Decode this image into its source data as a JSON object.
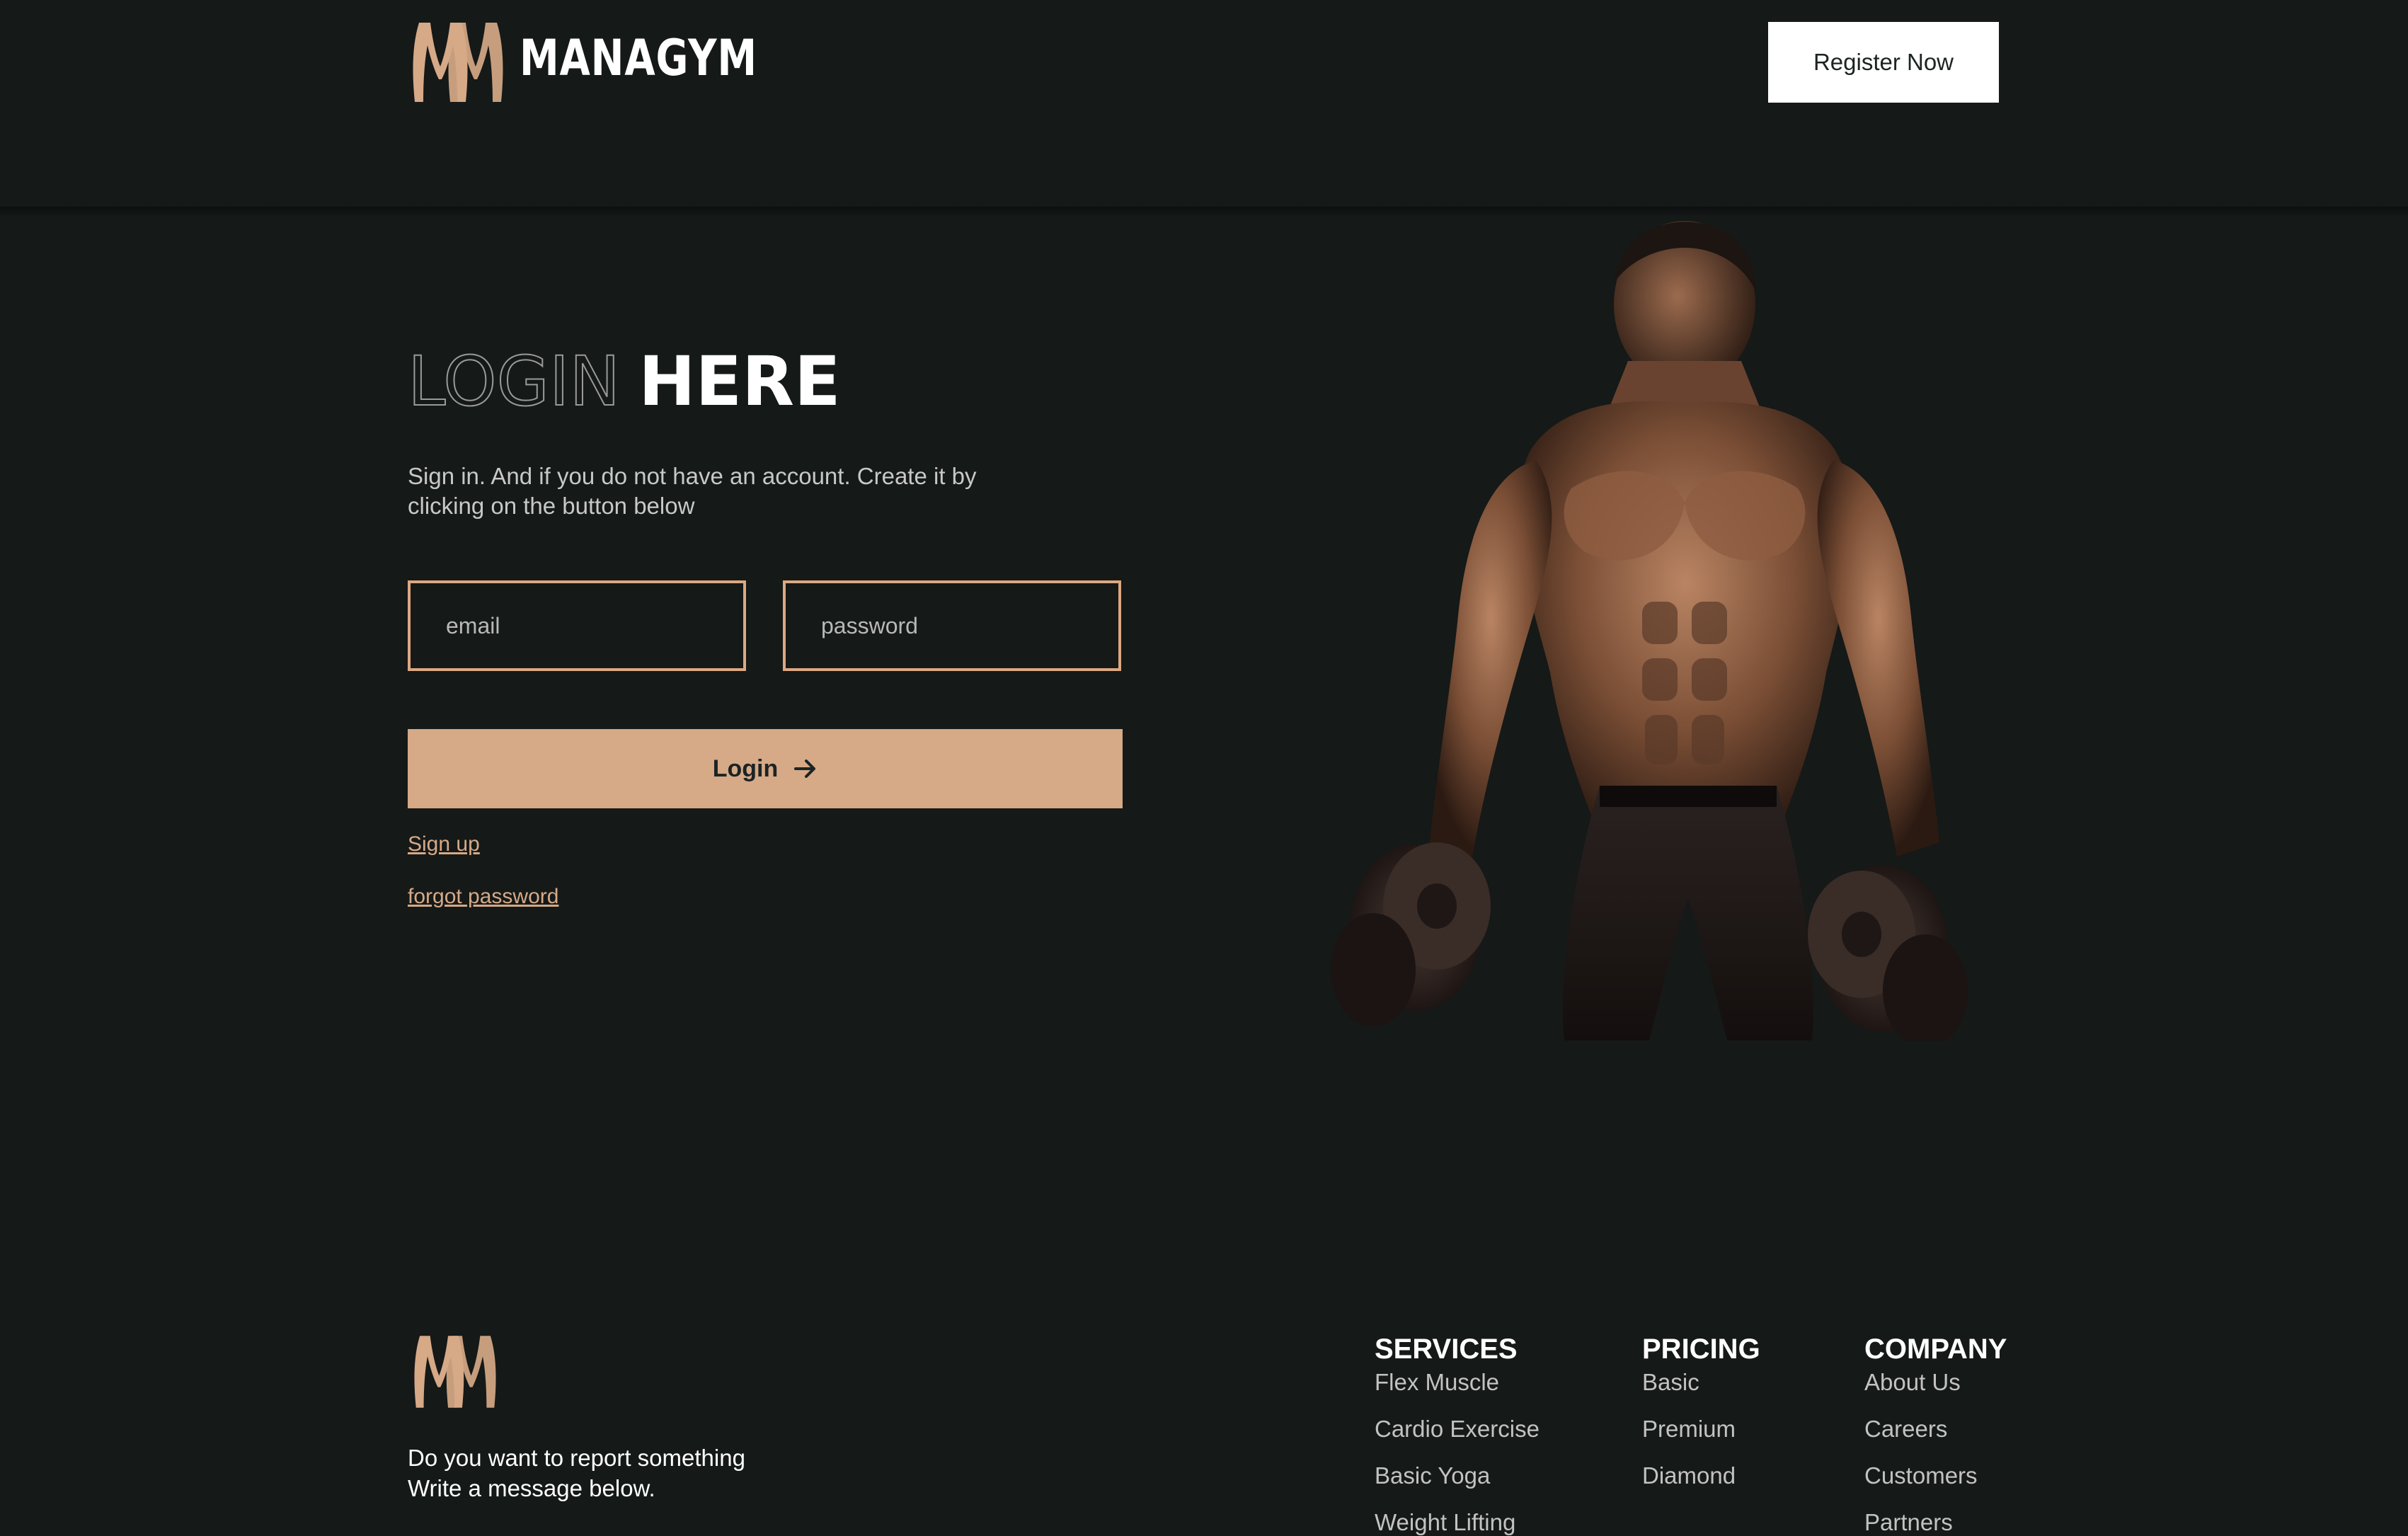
{
  "header": {
    "brand": "MANAGYM",
    "register_label": "Register Now"
  },
  "login": {
    "title_outline": "LOGIN",
    "title_solid": "HERE",
    "subtitle_line1": "Sign in. And if you do not have an account. Create it by",
    "subtitle_line2": "clicking on the button below",
    "email_placeholder": "email",
    "password_placeholder": "password",
    "login_label": "Login",
    "signup_label": "Sign up",
    "forgot_label": "forgot password"
  },
  "footer": {
    "report_line1": "Do you want to report something",
    "report_line2": "Write a message below.",
    "columns": [
      {
        "title": "SERVICES",
        "items": [
          "Flex Muscle",
          "Cardio Exercise",
          "Basic Yoga",
          "Weight Lifting"
        ]
      },
      {
        "title": "PRICING",
        "items": [
          "Basic",
          "Premium",
          "Diamond"
        ]
      },
      {
        "title": "COMPANY",
        "items": [
          "About Us",
          "Careers",
          "Customers",
          "Partners"
        ]
      }
    ]
  },
  "colors": {
    "background": "#151918",
    "accent": "#d6a987",
    "field_border": "#dca882",
    "text_light": "#ffffff"
  },
  "icons": [
    "logo-mark-icon",
    "arrow-right-icon"
  ]
}
